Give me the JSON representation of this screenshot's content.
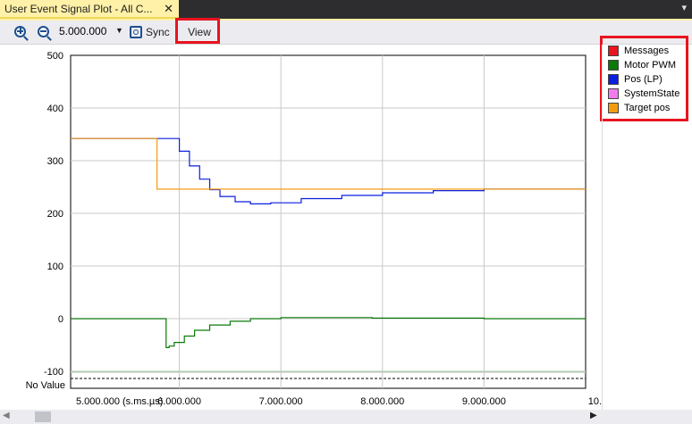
{
  "tab": {
    "title": "User Event Signal Plot - All C...",
    "close": "✕",
    "menu": "▾"
  },
  "toolbar": {
    "zoom_value": "5.000.000",
    "sync_label": "Sync",
    "view_label": "View"
  },
  "chart_data": {
    "type": "line",
    "title": "",
    "xlabel": "",
    "ylabel": "",
    "x_tick_labels": [
      "5.000.000 (s.ms.µs)",
      "6.000.000",
      "7.000.000",
      "8.000.000",
      "9.000.000",
      "10."
    ],
    "y_tick_labels": [
      "500",
      "400",
      "300",
      "200",
      "100",
      "0",
      "-100"
    ],
    "no_value_label": "No Value",
    "ylim": [
      -100,
      500
    ],
    "grid": true,
    "legend_placement": "right",
    "series": [
      {
        "name": "Messages",
        "color": "#e8141f",
        "x": [],
        "y": []
      },
      {
        "name": "Motor PWM",
        "color": "#0a7a0a",
        "x": [
          4.93,
          5.87,
          5.87,
          5.9,
          5.95,
          6.05,
          6.15,
          6.3,
          6.5,
          6.7,
          7.0,
          7.4,
          7.9,
          9.0,
          10.0
        ],
        "y": [
          0,
          0,
          -55,
          -52,
          -45,
          -33,
          -22,
          -12,
          -5,
          0,
          2,
          2,
          1,
          0,
          0
        ]
      },
      {
        "name": "Pos (LP)",
        "color": "#0a1fe0",
        "x": [
          4.93,
          5.9,
          6.0,
          6.1,
          6.2,
          6.3,
          6.4,
          6.55,
          6.7,
          6.9,
          7.2,
          7.6,
          8.0,
          8.5,
          9.0,
          10.0
        ],
        "y": [
          342,
          342,
          318,
          290,
          265,
          245,
          232,
          222,
          218,
          220,
          228,
          234,
          239,
          243,
          246,
          246
        ]
      },
      {
        "name": "SystemState",
        "color": "#f07cf0",
        "x": [],
        "y": []
      },
      {
        "name": "Target pos",
        "color": "#f39c12",
        "x": [
          4.93,
          5.78,
          5.78,
          10.0
        ],
        "y": [
          342,
          342,
          246,
          246
        ]
      }
    ]
  }
}
